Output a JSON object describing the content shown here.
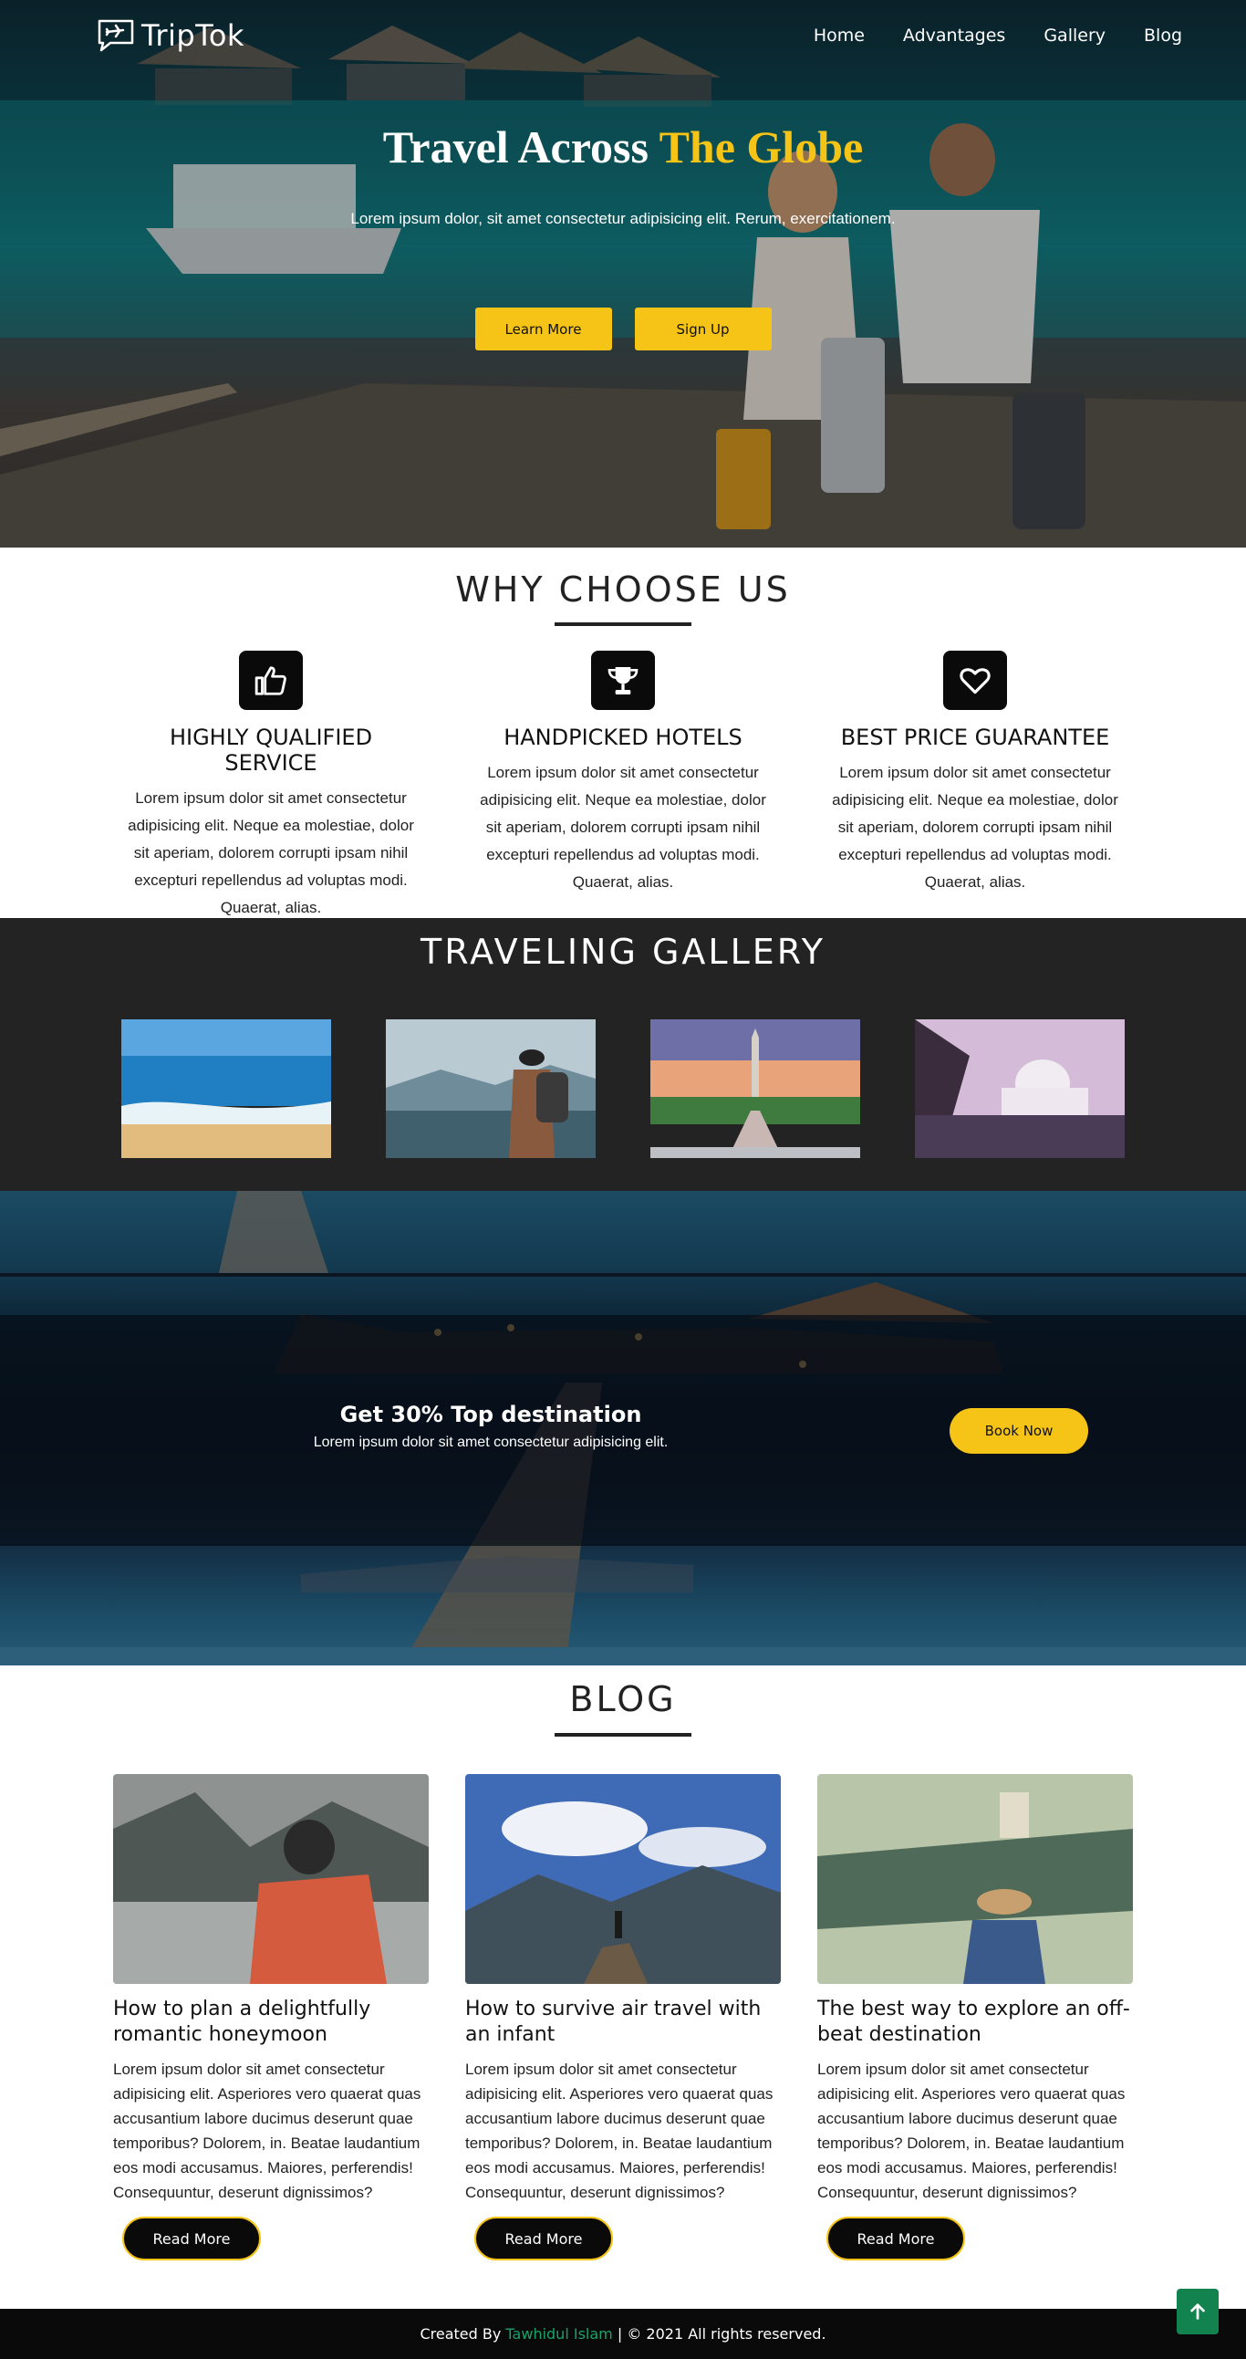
{
  "brand": {
    "name": "TripTok",
    "logo_icon": "plane-chat-icon"
  },
  "nav": {
    "items": [
      {
        "label": "Home"
      },
      {
        "label": "Advantages"
      },
      {
        "label": "Gallery"
      },
      {
        "label": "Blog"
      }
    ]
  },
  "hero": {
    "title_main": "Travel Across",
    "title_accent": "The Globe",
    "subtitle": "Lorem ipsum dolor, sit amet consectetur adipisicing elit. Rerum, exercitationem.",
    "btn_learn": "Learn More",
    "btn_signup": "Sign Up",
    "accent_color": "#f6c417"
  },
  "why": {
    "title": "WHY CHOOSE US",
    "features": [
      {
        "icon": "thumbs-up-icon",
        "title": "HIGHLY QUALIFIED SERVICE",
        "text": "Lorem ipsum dolor sit amet consectetur adipisicing elit. Neque ea molestiae, dolor sit aperiam, dolorem corrupti ipsam nihil excepturi repellendus ad voluptas modi. Quaerat, alias."
      },
      {
        "icon": "trophy-icon",
        "title": "HANDPICKED HOTELS",
        "text": "Lorem ipsum dolor sit amet consectetur adipisicing elit. Neque ea molestiae, dolor sit aperiam, dolorem corrupti ipsam nihil excepturi repellendus ad voluptas modi. Quaerat, alias."
      },
      {
        "icon": "heart-icon",
        "title": "BEST PRICE GUARANTEE",
        "text": "Lorem ipsum dolor sit amet consectetur adipisicing elit. Neque ea molestiae, dolor sit aperiam, dolorem corrupti ipsam nihil excepturi repellendus ad voluptas modi. Quaerat, alias."
      }
    ]
  },
  "gallery": {
    "title": "TRAVELING GALLERY"
  },
  "promo": {
    "heading": "Get 30% Top destination",
    "subtitle": "Lorem ipsum dolor sit amet consectetur adipisicing elit.",
    "button": "Book Now"
  },
  "blog": {
    "title": "BLOG",
    "posts": [
      {
        "title": "How to plan a delightfully romantic honeymoon",
        "text": "Lorem ipsum dolor sit amet consectetur adipisicing elit. Asperiores vero quaerat quas accusantium labore ducimus deserunt quae temporibus? Dolorem, in. Beatae laudantium eos modi accusamus. Maiores, perferendis! Consequuntur, deserunt dignissimos?",
        "button": "Read More"
      },
      {
        "title": "How to survive air travel with an infant",
        "text": "Lorem ipsum dolor sit amet consectetur adipisicing elit. Asperiores vero quaerat quas accusantium labore ducimus deserunt quae temporibus? Dolorem, in. Beatae laudantium eos modi accusamus. Maiores, perferendis! Consequuntur, deserunt dignissimos?",
        "button": "Read More"
      },
      {
        "title": "The best way to explore an off-beat destination",
        "text": "Lorem ipsum dolor sit amet consectetur adipisicing elit. Asperiores vero quaerat quas accusantium labore ducimus deserunt quae temporibus? Dolorem, in. Beatae laudantium eos modi accusamus. Maiores, perferendis! Consequuntur, deserunt dignissimos?",
        "button": "Read More"
      }
    ]
  },
  "footer": {
    "created_by": "Created By",
    "author": "Tawhidul Islam",
    "rights": "| © 2021 All rights reserved.",
    "author_color": "#18a36b",
    "to_top_icon": "arrow-up-icon"
  }
}
